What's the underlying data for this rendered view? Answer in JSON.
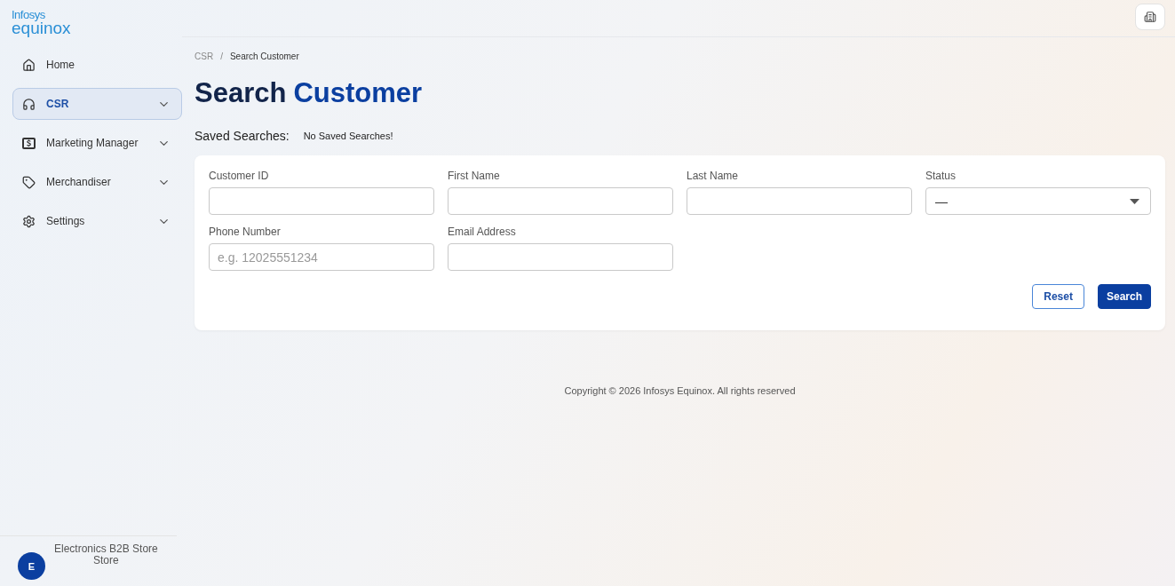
{
  "logo": {
    "brand": "Infosys",
    "product": "equinox"
  },
  "sidebar": {
    "items": [
      {
        "label": "Home",
        "kind": "link",
        "selected": false
      },
      {
        "label": "CSR",
        "kind": "group",
        "selected": true
      },
      {
        "label": "Marketing Manager",
        "kind": "group",
        "selected": false
      },
      {
        "label": "Merchandiser",
        "kind": "group",
        "selected": false
      },
      {
        "label": "Settings",
        "kind": "group",
        "selected": false
      }
    ],
    "store": {
      "initial": "E",
      "name": "Electronics B2B Store",
      "subtitle": "Store"
    }
  },
  "breadcrumb": {
    "items": [
      "CSR",
      "Search Customer"
    ],
    "separator": "/"
  },
  "title": {
    "lead": "Search",
    "accent": "Customer"
  },
  "saved_searches": {
    "label": "Saved Searches:",
    "value": "No Saved Searches!"
  },
  "form": {
    "fields": [
      {
        "label": "Customer ID",
        "kind": "text"
      },
      {
        "label": "First Name",
        "kind": "text"
      },
      {
        "label": "Last Name",
        "kind": "text"
      },
      {
        "label": "Status",
        "kind": "select",
        "value": "—"
      },
      {
        "label": "Phone Number",
        "kind": "text",
        "placeholder": "e.g. 12025551234"
      },
      {
        "label": "Email Address",
        "kind": "text"
      }
    ],
    "buttons": [
      {
        "label": "Reset",
        "kind": "secondary"
      },
      {
        "label": "Search",
        "kind": "primary"
      }
    ]
  },
  "footer": "Copyright © 2026 Infosys Equinox. All rights reserved"
}
